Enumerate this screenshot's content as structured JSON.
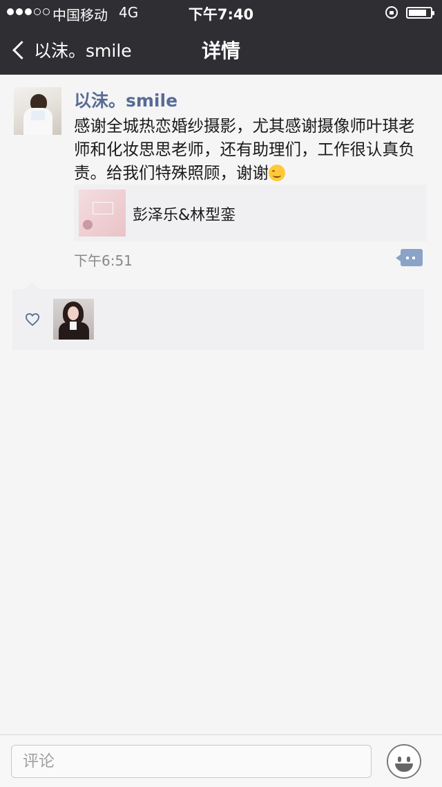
{
  "status_bar": {
    "signal_filled": 3,
    "signal_total": 5,
    "carrier": "中国移动",
    "network": "4G",
    "time": "下午7:40",
    "icons": [
      "orientation-lock-icon",
      "battery-icon"
    ],
    "battery_level": 0.85
  },
  "nav": {
    "back_label": "以沫。smile",
    "title": "详情"
  },
  "post": {
    "author": "以沫。smile",
    "text": "感谢全城热恋婚纱摄影，尤其感谢摄像师叶琪老师和化妆思思老师，还有助理们，工作很认真负责。给我们特殊照顾，谢谢",
    "emoji": "smile-emoji",
    "share": {
      "title": "彭泽乐&林型銮"
    },
    "time": "下午6:51"
  },
  "likes": {
    "icon": "heart-icon",
    "count": 1
  },
  "composer": {
    "placeholder": "评论",
    "value": "",
    "emoji_button": "emoji-icon"
  },
  "colors": {
    "nav_background": "#2f2f33",
    "author_link": "#576b95",
    "action_button": "#8ba3c7",
    "page_background": "#f5f5f5",
    "panel_background": "#f0f0f2"
  }
}
